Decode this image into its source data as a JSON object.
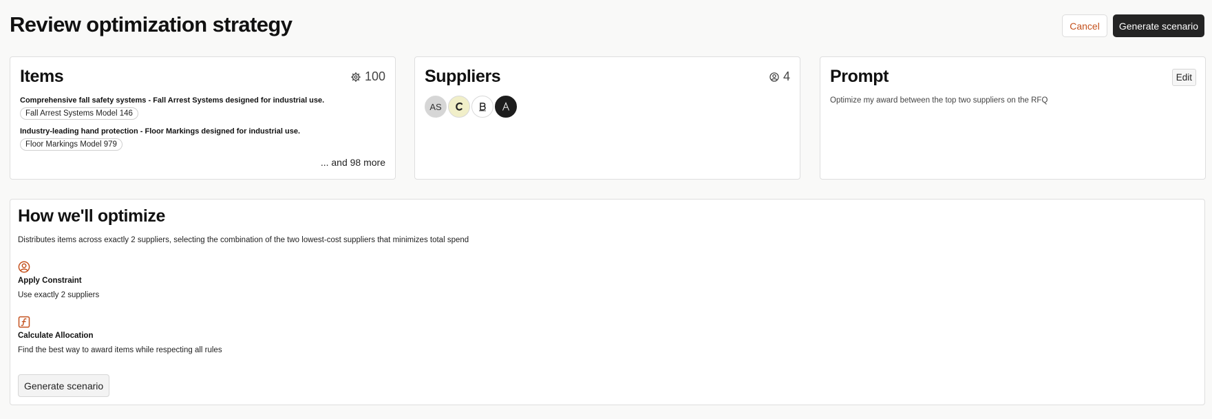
{
  "header": {
    "title": "Review optimization strategy",
    "cancel_label": "Cancel",
    "generate_label": "Generate scenario"
  },
  "items_card": {
    "title": "Items",
    "count": "100",
    "count_icon": "gear-icon",
    "items": [
      {
        "title": "Comprehensive fall safety systems - Fall Arrest Systems designed for industrial use.",
        "tag": "Fall Arrest Systems Model 146"
      },
      {
        "title": "Industry-leading hand protection - Floor Markings designed for industrial use.",
        "tag": "Floor Markings Model 979"
      }
    ],
    "more_text": "... and 98 more"
  },
  "suppliers_card": {
    "title": "Suppliers",
    "count": "4",
    "count_icon": "user-circle-icon",
    "avatars": [
      {
        "label": "AS",
        "icon": "initials-avatar",
        "color": "#d6d6d6"
      },
      {
        "label": "",
        "icon": "c-logo-icon",
        "color": "#f1efc9"
      },
      {
        "label": "",
        "icon": "b-logo-icon",
        "color": "#ffffff"
      },
      {
        "label": "",
        "icon": "a-logo-icon",
        "color": "#1d1d1d"
      }
    ]
  },
  "prompt_card": {
    "title": "Prompt",
    "edit_label": "Edit",
    "text": "Optimize my award between the top two suppliers on the RFQ"
  },
  "optimize": {
    "title": "How we'll optimize",
    "description": "Distributes items across exactly 2 suppliers, selecting the combination of the two lowest-cost suppliers that minimizes total spend",
    "steps": [
      {
        "icon": "user-circle-icon",
        "title": "Apply Constraint",
        "description": "Use exactly 2 suppliers"
      },
      {
        "icon": "function-icon",
        "title": "Calculate Allocation",
        "description": "Find the best way to award items while respecting all rules"
      }
    ],
    "generate_label": "Generate scenario"
  },
  "colors": {
    "accent": "#c4511d",
    "primary_button": "#242424"
  }
}
